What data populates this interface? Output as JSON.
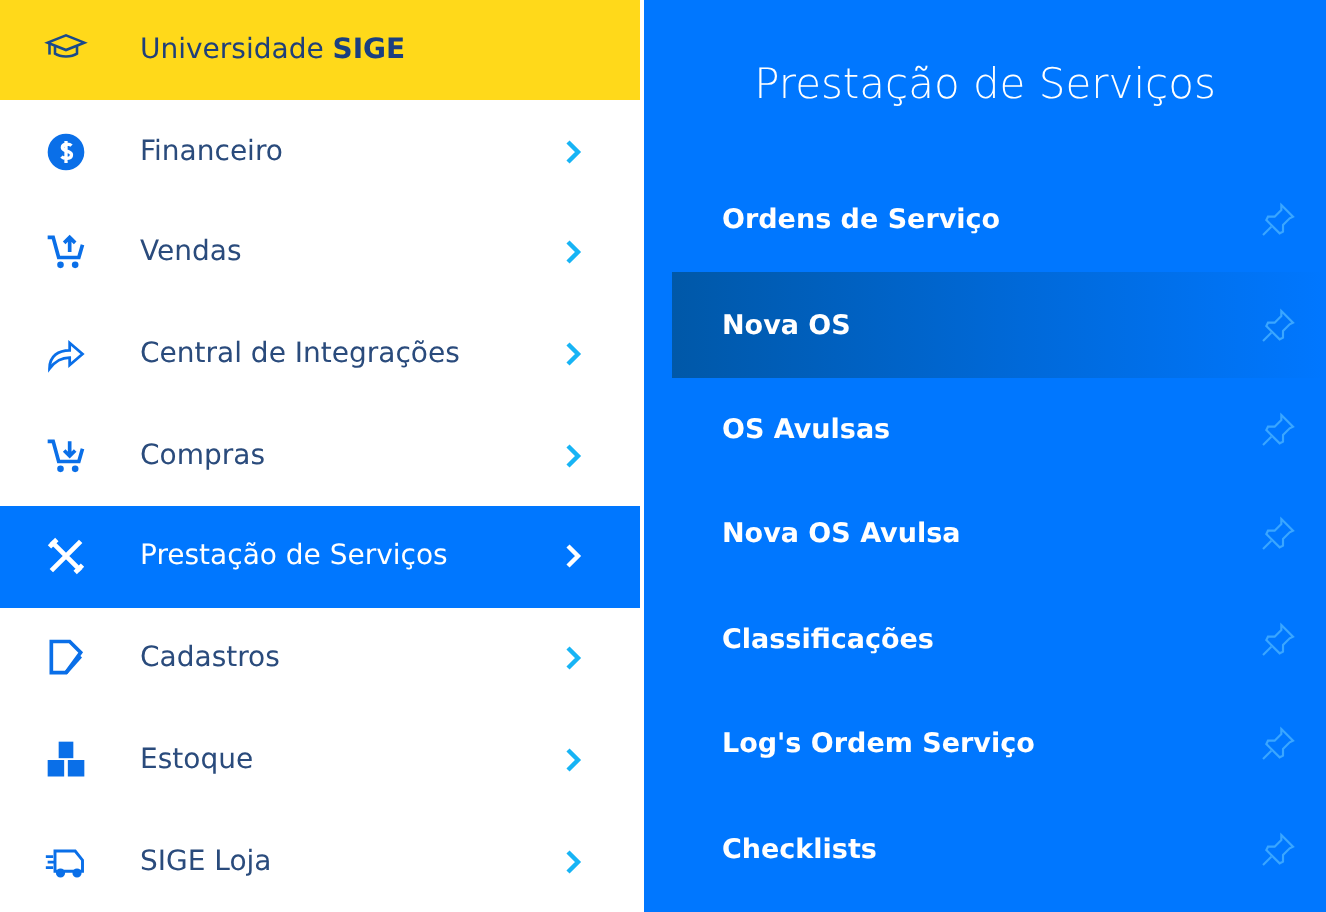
{
  "header": {
    "label": "Universidade **SIGE**"
  },
  "menu": [
    {
      "label": "Financeiro",
      "selected": false
    },
    {
      "label": "Vendas",
      "selected": false
    },
    {
      "label": "Central de Integrações",
      "selected": false
    },
    {
      "label": "Compras",
      "selected": false
    },
    {
      "label": "Prestação de Serviços",
      "selected": true
    },
    {
      "label": "Cadastros",
      "selected": false
    },
    {
      "label": "Estoque",
      "selected": false
    },
    {
      "label": "SIGE Loja",
      "selected": false
    }
  ],
  "submenu": {
    "title": "Prestação de Serviços",
    "items": [
      {
        "label": "Ordens de Serviço",
        "selected": false
      },
      {
        "label": "Nova OS",
        "selected": true
      },
      {
        "label": "OS Avulsas",
        "selected": false
      },
      {
        "label": "Nova OS Avulsa",
        "selected": false
      },
      {
        "label": "Classificações",
        "selected": false
      },
      {
        "label": "Log's Ordem Serviço",
        "selected": false
      },
      {
        "label": "Checklists",
        "selected": false
      }
    ]
  }
}
